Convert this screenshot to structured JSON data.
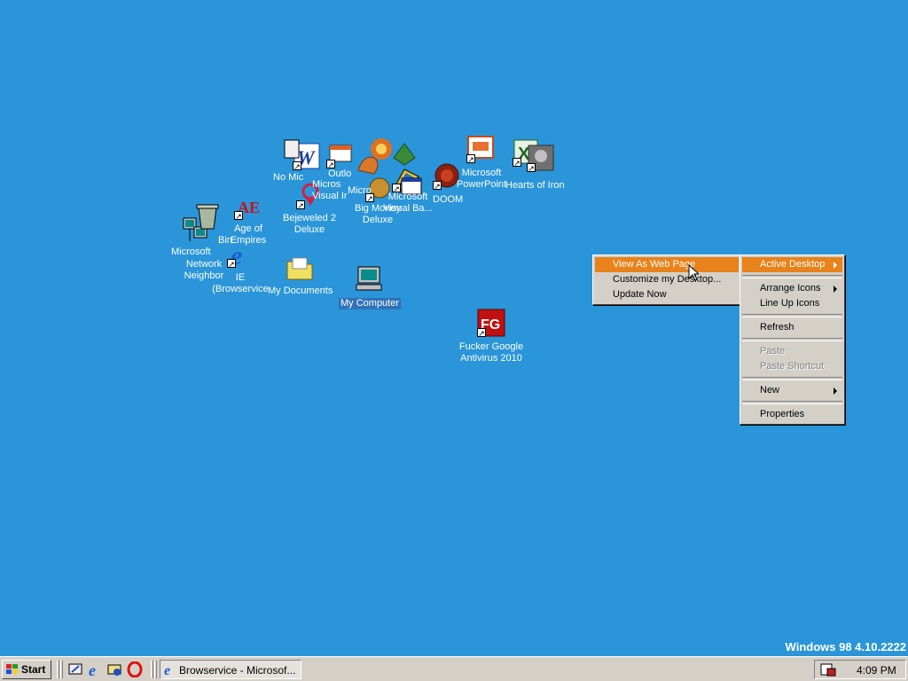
{
  "desktop": {
    "icons": {
      "network": "Network Neighbor",
      "microsoft_small": "Microsoft",
      "recycle_bin": "Bin",
      "age_of_empires": "Age of Empires",
      "ie": "IE (Browservice",
      "bejeweled": "Bejeweled 2 Deluxe",
      "my_documents": "My Documents",
      "my_computer": "My Computer",
      "big_money": "Big Money Deluxe",
      "visual_basic": "Microsoft Visual Ba...",
      "doom": "DOOM",
      "powerpoint": "Microsoft PowerPoint",
      "hearts_of_iron": "Hearts of Iron",
      "fucker_google": "Fucker Google Antivirus 2010",
      "overlap_1": "No Mic",
      "overlap_2": "Micros",
      "overlap_3": "Outlo",
      "overlap_4": "Visual Ir",
      "overlap_5": "Micro"
    }
  },
  "context_menu": {
    "items": [
      {
        "label": "Active Desktop",
        "has_submenu": true,
        "highlighted": true
      },
      {
        "label": "Arrange Icons",
        "has_submenu": true
      },
      {
        "label": "Line Up Icons"
      },
      {
        "label": "Refresh"
      },
      {
        "label": "Paste",
        "disabled": true
      },
      {
        "label": "Paste Shortcut",
        "disabled": true
      },
      {
        "label": "New",
        "has_submenu": true
      },
      {
        "label": "Properties"
      }
    ]
  },
  "submenu": {
    "items": [
      {
        "label": "View As Web Page",
        "highlighted": true
      },
      {
        "label": "Customize my Desktop..."
      },
      {
        "label": "Update Now"
      }
    ]
  },
  "taskbar": {
    "start_label": "Start",
    "task_label": "Browservice - Microsof...",
    "clock": "4:09 PM"
  },
  "version_text": "Windows 98 4.10.2222",
  "colors": {
    "desktop": "#2a95d8",
    "highlight": "#e8821a",
    "face": "#d4d0c8"
  }
}
